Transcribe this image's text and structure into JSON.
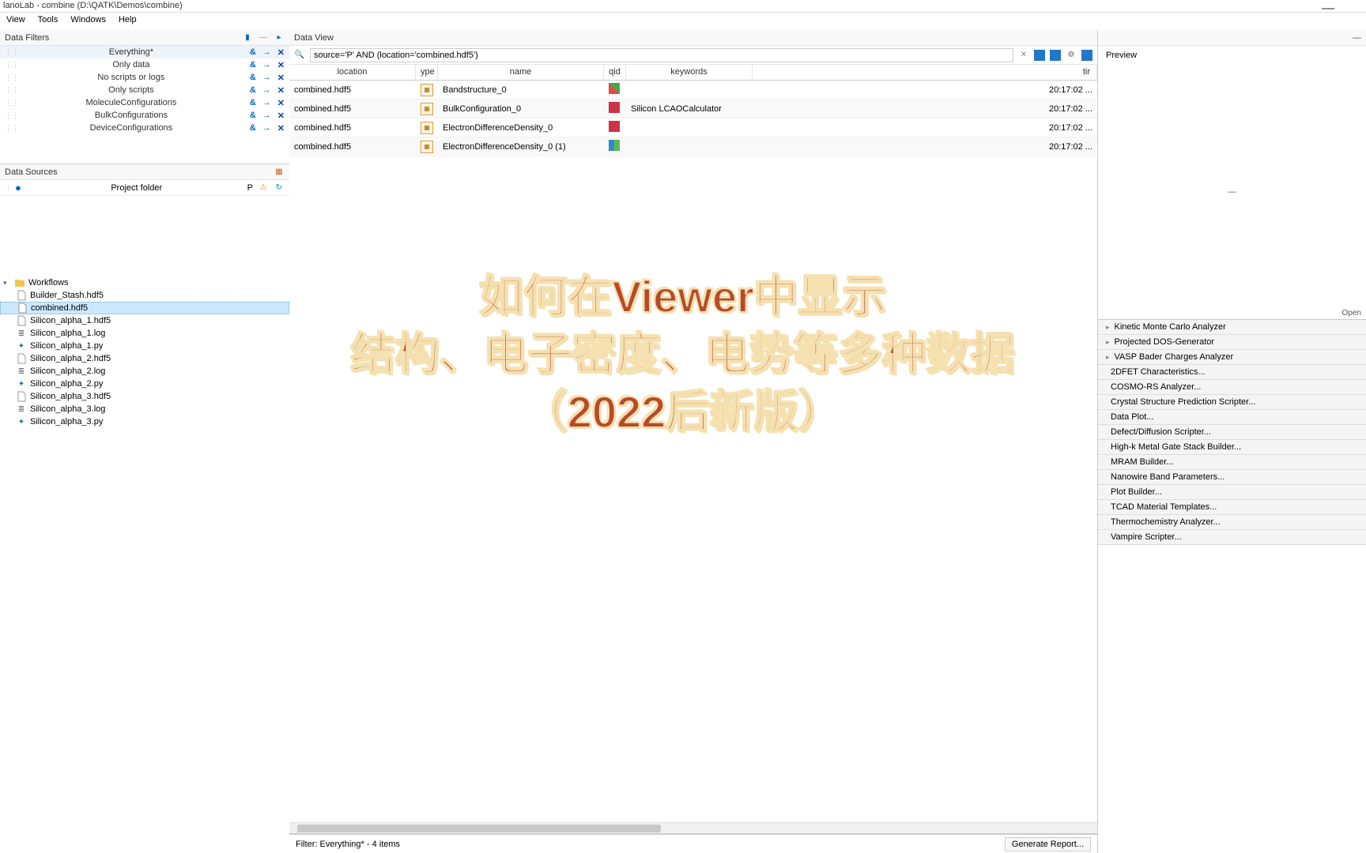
{
  "window": {
    "title": "lanoLab - combine (D:\\QATK\\Demos\\combine)"
  },
  "menubar": [
    "View",
    "Tools",
    "Windows",
    "Help"
  ],
  "filters_panel": {
    "title": "Data Filters",
    "items": [
      {
        "label": "Everything*",
        "a1": "&",
        "a2": "→",
        "a3": "✕"
      },
      {
        "label": "Only data",
        "a1": "&",
        "a2": "→",
        "a3": "✕"
      },
      {
        "label": "No scripts or logs",
        "a1": "&",
        "a2": "→",
        "a3": "✕"
      },
      {
        "label": "Only scripts",
        "a1": "&",
        "a2": "→",
        "a3": "✕"
      },
      {
        "label": "MoleculeConfigurations",
        "a1": "&",
        "a2": "→",
        "a3": "✕"
      },
      {
        "label": "BulkConfigurations",
        "a1": "&",
        "a2": "→",
        "a3": "✕"
      },
      {
        "label": "DeviceConfigurations",
        "a1": "&",
        "a2": "→",
        "a3": "✕"
      }
    ]
  },
  "sources_panel": {
    "title": "Data Sources",
    "project_label": "Project folder",
    "p_label": "P",
    "folder": "Workflows",
    "files": [
      {
        "name": "Builder_Stash.hdf5",
        "type": "hdf5",
        "selected": false
      },
      {
        "name": "combined.hdf5",
        "type": "hdf5",
        "selected": true
      },
      {
        "name": "Silicon_alpha_1.hdf5",
        "type": "hdf5",
        "selected": false
      },
      {
        "name": "Silicon_alpha_1.log",
        "type": "log",
        "selected": false
      },
      {
        "name": "Silicon_alpha_1.py",
        "type": "py",
        "selected": false
      },
      {
        "name": "Silicon_alpha_2.hdf5",
        "type": "hdf5",
        "selected": false
      },
      {
        "name": "Silicon_alpha_2.log",
        "type": "log",
        "selected": false
      },
      {
        "name": "Silicon_alpha_2.py",
        "type": "py",
        "selected": false
      },
      {
        "name": "Silicon_alpha_3.hdf5",
        "type": "hdf5",
        "selected": false
      },
      {
        "name": "Silicon_alpha_3.log",
        "type": "log",
        "selected": false
      },
      {
        "name": "Silicon_alpha_3.py",
        "type": "py",
        "selected": false
      }
    ]
  },
  "dataview": {
    "title": "Data View",
    "search_value": "source='P' AND (location='combined.hdf5')",
    "columns": {
      "location": "location",
      "type": "ype",
      "name": "name",
      "qid": "qid",
      "keywords": "keywords",
      "time": "tir"
    },
    "rows": [
      {
        "location": "combined.hdf5",
        "name": "Bandstructure_0",
        "keywords": "",
        "time": "20:17:02 ...",
        "qid_color": "linear-gradient(45deg,#e84545 50%,#45a845 50%)"
      },
      {
        "location": "combined.hdf5",
        "name": "BulkConfiguration_0",
        "keywords": "Silicon LCAOCalculator",
        "time": "20:17:02 ...",
        "qid_color": "#cc3344"
      },
      {
        "location": "combined.hdf5",
        "name": "ElectronDifferenceDensity_0",
        "keywords": "",
        "time": "20:17:02 ...",
        "qid_color": "#cc3344"
      },
      {
        "location": "combined.hdf5",
        "name": "ElectronDifferenceDensity_0 (1)",
        "keywords": "",
        "time": "20:17:02 ...",
        "qid_color": "linear-gradient(90deg,#3388cc 50%,#55bb55 50%)"
      }
    ],
    "status": "Filter: Everything* - 4 items",
    "generate_label": "Generate Report..."
  },
  "preview": {
    "title": "Preview",
    "open_label": "Open"
  },
  "plugins": [
    "Kinetic Monte Carlo Analyzer",
    "Projected DOS-Generator",
    "VASP Bader Charges Analyzer",
    "2DFET Characteristics...",
    "COSMO-RS Analyzer...",
    "Crystal Structure Prediction Scripter...",
    "Data Plot...",
    "Defect/Diffusion Scripter...",
    "High-k Metal Gate Stack Builder...",
    "MRAM Builder...",
    "Nanowire Band Parameters...",
    "Plot Builder...",
    "TCAD Material Templates...",
    "Thermochemistry Analyzer...",
    "Vampire Scripter..."
  ],
  "overlay": {
    "line1": "如何在Viewer中显示",
    "line2": "结构、电子密度、电势等多种数据",
    "line3": "（2022后新版）"
  }
}
